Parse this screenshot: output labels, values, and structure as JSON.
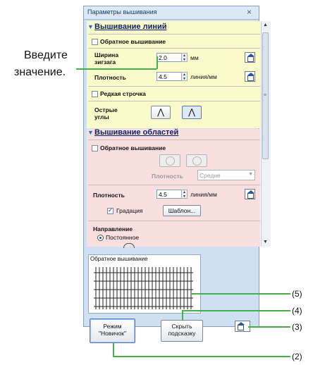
{
  "window": {
    "title": "Параметры вышивания",
    "close_glyph": "×"
  },
  "line_section": {
    "header": "Вышивание линий",
    "reverse": "Обратное вышивание",
    "zigzag_label_1": "Ширина",
    "zigzag_label_2": "зигзага",
    "zigzag_value": "2.0",
    "zigzag_unit": "мм",
    "density_label": "Плотность",
    "density_value": "4.5",
    "density_unit": "линия/мм",
    "sparse": "Редкая строчка",
    "corners_1": "Острые",
    "corners_2": "углы"
  },
  "area_section": {
    "header": "Вышивание областей",
    "reverse": "Обратное вышивание",
    "sub_density_label": "Плотность",
    "sub_density_value": "Средне",
    "density_label": "Плотность",
    "density_value": "4.5",
    "density_unit": "линия/мм",
    "gradation": "Градация",
    "gradation_checked": true,
    "template_button": "Шаблон...",
    "direction_label": "Направление",
    "direction_option": "Постоянное"
  },
  "preview": {
    "caption": "Обратное вышивание"
  },
  "buttons": {
    "novice_1": "Режим",
    "novice_2": "\"Новичок\"",
    "hide_1": "Скрыть",
    "hide_2": "подсказку"
  },
  "callouts": {
    "enter_1": "Введите",
    "enter_2": "значение.",
    "c5": "(5)",
    "c4": "(4)",
    "c3": "(3)",
    "c2": "(2)"
  },
  "colors": {
    "line_bg": "#fbfacb",
    "area_bg": "#f9e0de",
    "callout": "#44b048"
  }
}
